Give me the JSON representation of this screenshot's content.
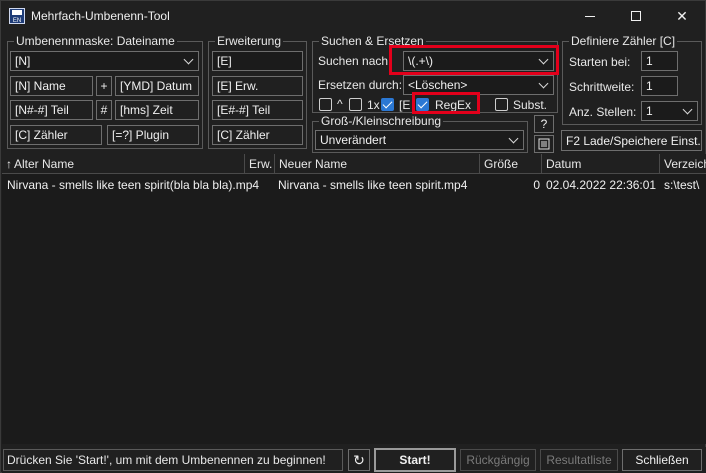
{
  "window": {
    "title": "Mehrfach-Umbenenn-Tool",
    "minimize": "—",
    "maximize": "☐",
    "close": "✕"
  },
  "mask_group": {
    "label": "Umbenennmaske: Dateiname",
    "value": "[N]",
    "buttons": {
      "name": "[N]  Name",
      "plus": "+",
      "date": "[YMD]  Datum",
      "part": "[N#-#] Teil",
      "hash": "#",
      "time": "[hms]  Zeit",
      "counter": "[C]  Zähler",
      "plugin": "[=?]  Plugin"
    }
  },
  "ext_group": {
    "label": "Erweiterung",
    "value": "[E]",
    "buttons": {
      "ext": "[E]  Erw.",
      "part": "[E#-#] Teil",
      "counter": "[C]  Zähler"
    }
  },
  "search_group": {
    "label": "Suchen & Ersetzen",
    "search_label": "Suchen nach:",
    "search_value": "\\(.+\\)",
    "replace_label": "Ersetzen durch:",
    "replace_value": "<Löschen>",
    "opt_caret": "^",
    "opt_once": "1x",
    "opt_e": "[E",
    "opt_regex": "RegEx",
    "opt_subst": "Subst.",
    "regex_checked": true,
    "help_button": "?"
  },
  "case_group": {
    "label": "Groß-/Kleinschreibung",
    "value": "Unverändert"
  },
  "counter_group": {
    "label": "Definiere Zähler [C]",
    "start_label": "Starten bei:",
    "start_value": "1",
    "step_label": "Schrittweite:",
    "step_value": "1",
    "digits_label": "Anz. Stellen:",
    "digits_value": "1",
    "load_save": "F2 Lade/Speichere Einst."
  },
  "list": {
    "columns": [
      "Alter Name",
      "Erw.",
      "Neuer Name",
      "Größe",
      "Datum",
      "Verzeichnis"
    ],
    "columns_display": [
      "Alter Name",
      "Erw.",
      "Neuer Name",
      "Größe",
      "Datum",
      "Verzeich"
    ],
    "sort_indicator": "↑",
    "rows": [
      {
        "old_name": "Nirvana - smells like teen spirit(bla bla bla).mp4",
        "ext": "",
        "new_name": "Nirvana - smells like teen spirit.mp4",
        "size": "0",
        "date": "02.04.2022 22:36:01",
        "dir": "s:\\test\\"
      }
    ]
  },
  "status": {
    "text": "Drücken Sie 'Start!', um mit dem Umbenennen zu beginnen!",
    "refresh_icon": "↻",
    "start": "Start!",
    "undo": "Rückgängig",
    "result_list": "Resultatliste",
    "close": "Schließen"
  },
  "colors": {
    "background": "#202020",
    "highlight": "#e3001b",
    "checkbox_checked": "#2b78d4"
  }
}
